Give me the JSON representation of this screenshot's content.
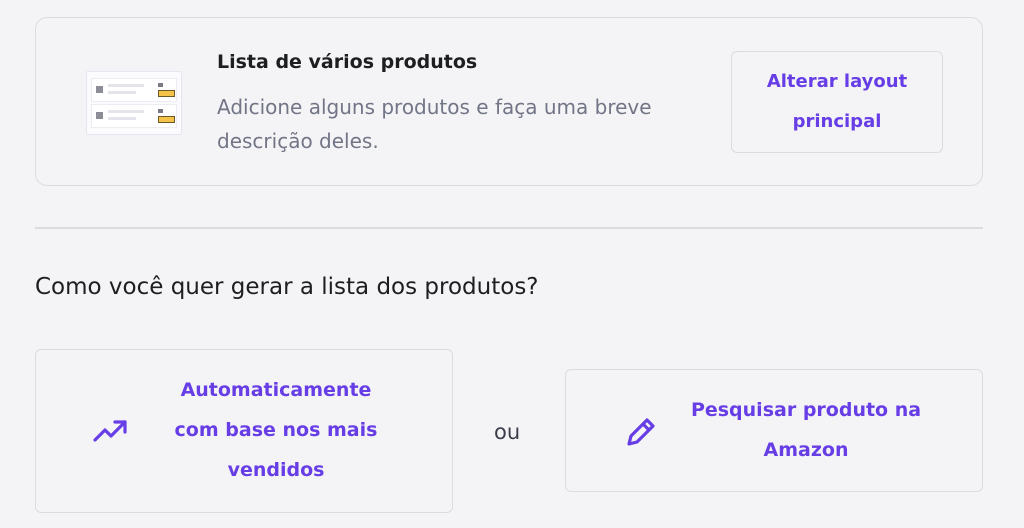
{
  "layout_card": {
    "title": "Lista de vários produtos",
    "description": "Adicione alguns produtos e faça uma breve descrição deles.",
    "change_button": "Alterar layout principal",
    "thumbnail_icon": "product-list-layout-icon"
  },
  "question": "Como você quer gerar a lista dos produtos?",
  "options": {
    "auto": {
      "label": "Automaticamente com base nos mais vendidos",
      "icon": "trending-up-icon"
    },
    "separator": "ou",
    "search": {
      "label": "Pesquisar produto na Amazon",
      "icon": "pencil-icon"
    }
  },
  "colors": {
    "accent": "#673de6",
    "border": "#dadce0",
    "background": "#f4f4f6",
    "text_primary": "#1d1e20",
    "text_muted": "#727586"
  }
}
